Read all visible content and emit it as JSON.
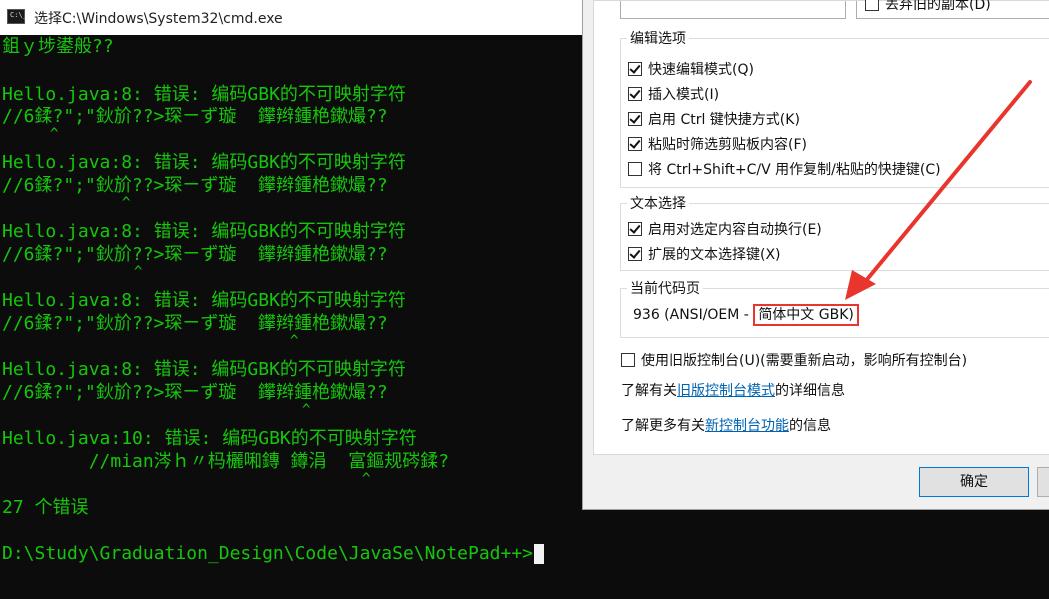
{
  "window": {
    "title": "选择C:\\Windows\\System32\\cmd.exe",
    "icon": "console-icon",
    "icon_glyph": "C:\\_"
  },
  "console": {
    "lines": [
      "鉏ｙ埗鍙般??",
      "",
      "Hello.java:8: 错误: 编码GBK的不可映射字符",
      "//6鍒?\";\"鈥斺??>琛ㄧず璇  鑻辫鍾栬鏉熶??",
      "",
      "Hello.java:8: 错误: 编码GBK的不可映射字符",
      "//6鍒?\";\"鈥斺??>琛ㄧず璇  鑻辫鍾栬鏉熶??",
      "",
      "Hello.java:8: 错误: 编码GBK的不可映射字符",
      "//6鍒?\";\"鈥斺??>琛ㄧず璇  鑻辫鍾栬鏉熶??",
      "",
      "Hello.java:8: 错误: 编码GBK的不可映射字符",
      "//6鍒?\";\"鈥斺??>琛ㄧず璇  鑻辫鍾栬鏉熶??",
      "",
      "Hello.java:8: 错误: 编码GBK的不可映射字符",
      "//6鍒?\";\"鈥斺??>琛ㄧず璇  鑻辫鍾栬鏉熶??",
      "",
      "Hello.java:10: 错误: 编码GBK的不可映射字符",
      "        //mian涔ｈ〃杩欐啝鏄 鐏涓  富鏂规硶鍒?",
      "",
      "27 个错误",
      "",
      "D:\\Study\\Graduation_Design\\Code\\JavaSe\\NotePad++>"
    ],
    "caret": "^",
    "text_color": "#16c60c"
  },
  "dialog": {
    "top_checkbox_label": "丢弃旧的副本(D)",
    "edit_options": {
      "title": "编辑选项",
      "items": [
        {
          "label": "快速编辑模式(Q)",
          "checked": true
        },
        {
          "label": "插入模式(I)",
          "checked": true
        },
        {
          "label": "启用 Ctrl 键快捷方式(K)",
          "checked": true
        },
        {
          "label": "粘贴时筛选剪贴板内容(F)",
          "checked": true
        },
        {
          "label": "将 Ctrl+Shift+C/V 用作复制/粘贴的快捷键(C)",
          "checked": false
        }
      ]
    },
    "text_selection": {
      "title": "文本选择",
      "items": [
        {
          "label": "启用对选定内容自动换行(E)",
          "checked": true
        },
        {
          "label": "扩展的文本选择键(X)",
          "checked": true
        }
      ]
    },
    "codepage": {
      "title": "当前代码页",
      "prefix": "936  (ANSI/OEM - ",
      "highlight": "简体中文 GBK)"
    },
    "legacy": {
      "label": "使用旧版控制台(U)(需要重新启动，影响所有控制台)",
      "checked": false
    },
    "info1": {
      "before": "了解有关",
      "link": "旧版控制台模式",
      "after": "的详细信息"
    },
    "info2": {
      "before": "了解更多有关",
      "link": "新控制台功能",
      "after": "的信息"
    },
    "ok_label": "确定"
  },
  "annotation": {
    "color": "#e8352e"
  }
}
